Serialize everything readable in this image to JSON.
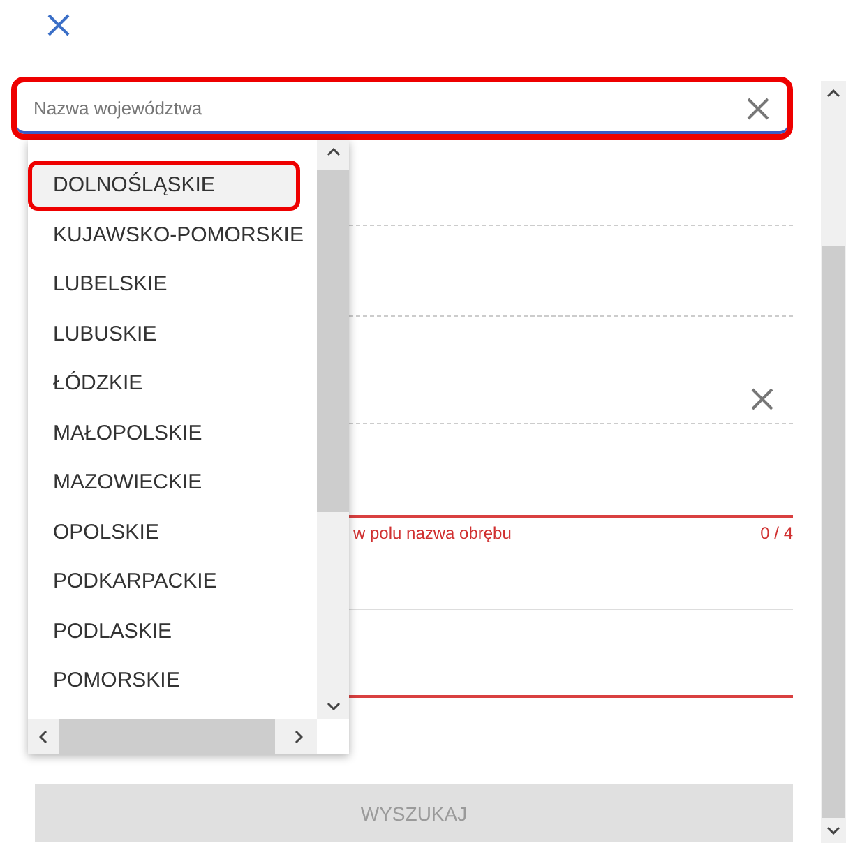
{
  "search": {
    "placeholder": "Nazwa województwa",
    "highlighted": true
  },
  "dropdown": {
    "items": [
      {
        "label": "DOLNOŚLĄSKIE",
        "selected": true
      },
      {
        "label": "KUJAWSKO-POMORSKIE",
        "selected": false
      },
      {
        "label": "LUBELSKIE",
        "selected": false
      },
      {
        "label": "LUBUSKIE",
        "selected": false
      },
      {
        "label": "ŁÓDZKIE",
        "selected": false
      },
      {
        "label": "MAŁOPOLSKIE",
        "selected": false
      },
      {
        "label": "MAZOWIECKIE",
        "selected": false
      },
      {
        "label": "OPOLSKIE",
        "selected": false
      },
      {
        "label": "PODKARPACKIE",
        "selected": false
      },
      {
        "label": "PODLASKIE",
        "selected": false
      },
      {
        "label": "POMORSKIE",
        "selected": false
      }
    ]
  },
  "form": {
    "error": "w polu nazwa obrębu",
    "counter": "0 / 4"
  },
  "search_button": {
    "label": "WYSZUKAJ",
    "disabled": true
  }
}
